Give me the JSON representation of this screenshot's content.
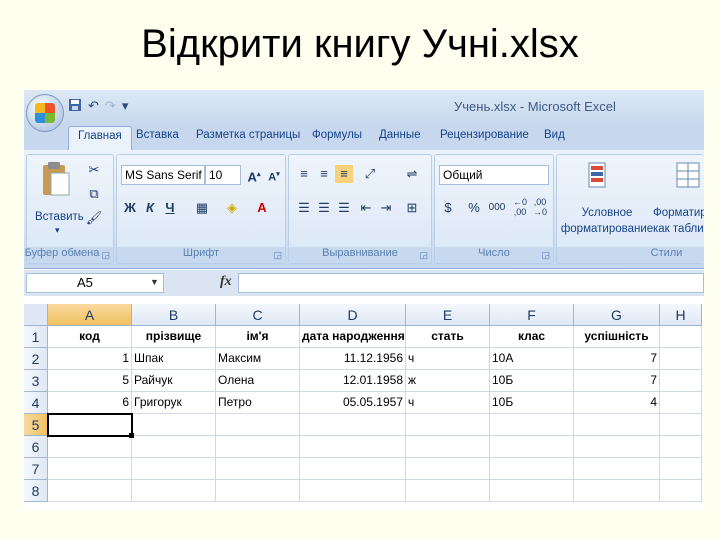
{
  "slide_title": "Відкрити книгу Учні.xlsx",
  "window": {
    "title": "Учень.xlsx - Microsoft Excel"
  },
  "quick_access": {
    "save_icon": "save-icon",
    "undo_icon": "undo-icon",
    "redo_icon": "redo-icon",
    "customize": "▾"
  },
  "tabs": [
    "Главная",
    "Вставка",
    "Разметка страницы",
    "Формулы",
    "Данные",
    "Рецензирование",
    "Вид"
  ],
  "active_tab": "Главная",
  "ribbon": {
    "clipboard": {
      "paste_label": "Вставить",
      "group_label": "Буфер обмена"
    },
    "font": {
      "font_name": "MS Sans Serif",
      "font_size": "10",
      "bold": "Ж",
      "italic": "К",
      "underline": "Ч",
      "group_label": "Шрифт"
    },
    "alignment": {
      "group_label": "Выравнивание"
    },
    "number": {
      "format": "Общий",
      "percent": "%",
      "thousands": "000",
      "group_label": "Число"
    },
    "styles": {
      "conditional_label": "Условное форматирование",
      "format_table_label": "Форматир как табли",
      "group_label": "Стили"
    }
  },
  "formula_bar": {
    "name_box": "A5",
    "fx": "fx",
    "formula": ""
  },
  "columns": [
    "A",
    "B",
    "C",
    "D",
    "E",
    "F",
    "G",
    "H"
  ],
  "rows": [
    "1",
    "2",
    "3",
    "4",
    "5",
    "6",
    "7",
    "8"
  ],
  "table": {
    "headers": [
      "код",
      "прізвище",
      "ім'я",
      "дата народження",
      "стать",
      "клас",
      "успішність"
    ],
    "rows": [
      [
        "1",
        "Шпак",
        "Максим",
        "11.12.1956",
        "ч",
        "10А",
        "7"
      ],
      [
        "5",
        "Райчук",
        "Олена",
        "12.01.1958",
        "ж",
        "10Б",
        "7"
      ],
      [
        "6",
        "Григорук",
        "Петро",
        "05.05.1957",
        "ч",
        "10Б",
        "4"
      ]
    ]
  },
  "colors": {
    "accent": "#15428b",
    "ribbon_bg": "#dbe7f6",
    "selected_header": "#f1c15f"
  }
}
